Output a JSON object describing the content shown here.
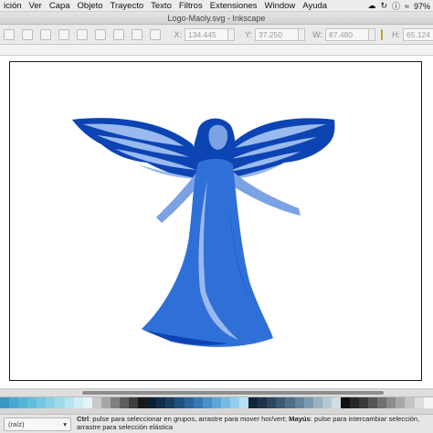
{
  "menubar": {
    "items": [
      "ición",
      "Ver",
      "Capa",
      "Objeto",
      "Trayecto",
      "Texto",
      "Filtros",
      "Extensiones",
      "Window",
      "Ayuda"
    ],
    "battery_label": "97%"
  },
  "window": {
    "title": "Logo-Maoly.svg - Inkscape"
  },
  "toolbar": {
    "x_label": "X:",
    "x_value": "134.445",
    "y_label": "Y:",
    "y_value": "37.250",
    "w_label": "W:",
    "w_value": "87.480",
    "h_label": "H:",
    "h_value": "65.124"
  },
  "canvas": {
    "artwork": {
      "primary": "#2f6fd8",
      "dark": "#0c44b4",
      "light": "#9ab9ec",
      "skin": "#7aa2e4"
    }
  },
  "palette": {
    "colors": [
      "#3b98c4",
      "#47a8d0",
      "#54b4d8",
      "#62bede",
      "#74c8e2",
      "#88d0e6",
      "#9edaec",
      "#b6e4f0",
      "#cdeef5",
      "#e0f4f8",
      "#c8c8c8",
      "#a6a6a6",
      "#808080",
      "#5e5e5e",
      "#3e3e3e",
      "#1a1a1a",
      "#0a1f34",
      "#102e4a",
      "#173f62",
      "#1f5180",
      "#2a659c",
      "#3579b4",
      "#4890c8",
      "#5ea6d8",
      "#77bbe4",
      "#95cfee",
      "#b5dff4",
      "#12263a",
      "#1c344c",
      "#2a4660",
      "#3b5a74",
      "#4e6f88",
      "#64849c",
      "#7d9bb0",
      "#98b2c4",
      "#b4c8d6",
      "#d0dde6",
      "#111111",
      "#262626",
      "#3a3a3a",
      "#555555",
      "#707070",
      "#8c8c8c",
      "#a8a8a8",
      "#c4c4c4",
      "#dedede",
      "#f5f5f5"
    ]
  },
  "statusbar": {
    "layer": "(raíz)",
    "ctrl_label": "Ctrl",
    "ctrl_text": ": pulse para seleccionar en grupos, arrastre para mover hor/vert; ",
    "shift_label": "Mayús",
    "shift_text": ": pulse para intercambiar selección, arrastre para selección elástica"
  }
}
